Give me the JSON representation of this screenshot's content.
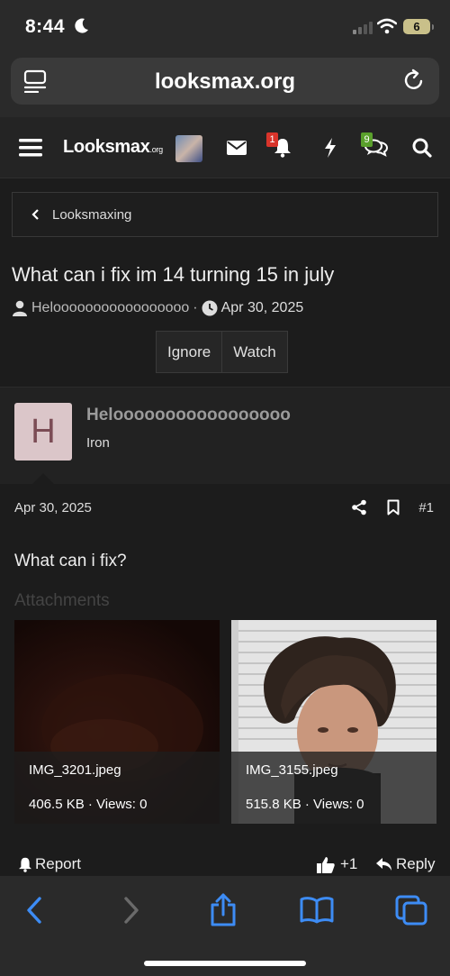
{
  "status_bar": {
    "time": "8:44",
    "battery": "6"
  },
  "browser": {
    "url": "looksmax.org"
  },
  "site_nav": {
    "logo_main": "Looksmax",
    "logo_suffix": ".org",
    "alerts_badge": "1",
    "conversations_badge": "9",
    "colors": {
      "alerts_badge": "#d9342b",
      "conversations_badge": "#5aa02c"
    }
  },
  "breadcrumb": {
    "label": "Looksmaxing"
  },
  "thread": {
    "title": "What can i fix im 14 turning 15 in july",
    "author": "Helooooooooooooooooo",
    "date": "Apr 30, 2025",
    "actions": {
      "ignore": "Ignore",
      "watch": "Watch"
    }
  },
  "post": {
    "avatar_letter": "H",
    "username": "Helooooooooooooooooo",
    "rank": "Iron",
    "date": "Apr 30, 2025",
    "number": "#1",
    "body": "What can i fix?",
    "attachments_label": "Attachments",
    "attachments": [
      {
        "name": "IMG_3201.jpeg",
        "info": "406.5 KB · Views: 0"
      },
      {
        "name": "IMG_3155.jpeg",
        "info": "515.8 KB · Views: 0"
      }
    ],
    "footer": {
      "report": "Report",
      "likes": "+1",
      "reply": "Reply"
    }
  }
}
